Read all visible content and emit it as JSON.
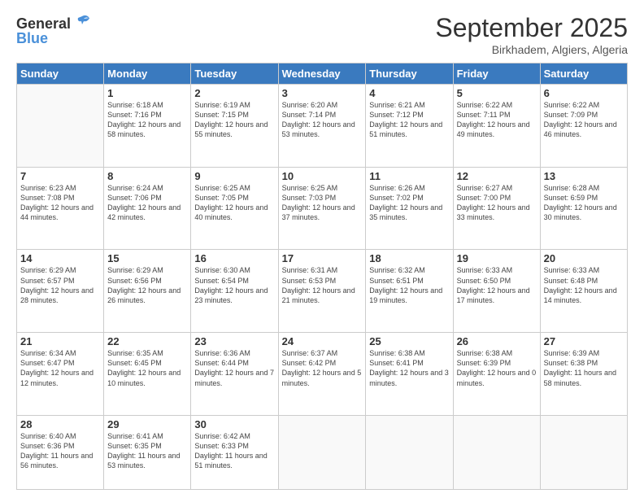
{
  "header": {
    "logo_general": "General",
    "logo_blue": "Blue",
    "month_year": "September 2025",
    "location": "Birkhadem, Algiers, Algeria"
  },
  "days_of_week": [
    "Sunday",
    "Monday",
    "Tuesday",
    "Wednesday",
    "Thursday",
    "Friday",
    "Saturday"
  ],
  "weeks": [
    [
      {
        "day": "",
        "info": ""
      },
      {
        "day": "1",
        "info": "Sunrise: 6:18 AM\nSunset: 7:16 PM\nDaylight: 12 hours and 58 minutes."
      },
      {
        "day": "2",
        "info": "Sunrise: 6:19 AM\nSunset: 7:15 PM\nDaylight: 12 hours and 55 minutes."
      },
      {
        "day": "3",
        "info": "Sunrise: 6:20 AM\nSunset: 7:14 PM\nDaylight: 12 hours and 53 minutes."
      },
      {
        "day": "4",
        "info": "Sunrise: 6:21 AM\nSunset: 7:12 PM\nDaylight: 12 hours and 51 minutes."
      },
      {
        "day": "5",
        "info": "Sunrise: 6:22 AM\nSunset: 7:11 PM\nDaylight: 12 hours and 49 minutes."
      },
      {
        "day": "6",
        "info": "Sunrise: 6:22 AM\nSunset: 7:09 PM\nDaylight: 12 hours and 46 minutes."
      }
    ],
    [
      {
        "day": "7",
        "info": "Sunrise: 6:23 AM\nSunset: 7:08 PM\nDaylight: 12 hours and 44 minutes."
      },
      {
        "day": "8",
        "info": "Sunrise: 6:24 AM\nSunset: 7:06 PM\nDaylight: 12 hours and 42 minutes."
      },
      {
        "day": "9",
        "info": "Sunrise: 6:25 AM\nSunset: 7:05 PM\nDaylight: 12 hours and 40 minutes."
      },
      {
        "day": "10",
        "info": "Sunrise: 6:25 AM\nSunset: 7:03 PM\nDaylight: 12 hours and 37 minutes."
      },
      {
        "day": "11",
        "info": "Sunrise: 6:26 AM\nSunset: 7:02 PM\nDaylight: 12 hours and 35 minutes."
      },
      {
        "day": "12",
        "info": "Sunrise: 6:27 AM\nSunset: 7:00 PM\nDaylight: 12 hours and 33 minutes."
      },
      {
        "day": "13",
        "info": "Sunrise: 6:28 AM\nSunset: 6:59 PM\nDaylight: 12 hours and 30 minutes."
      }
    ],
    [
      {
        "day": "14",
        "info": "Sunrise: 6:29 AM\nSunset: 6:57 PM\nDaylight: 12 hours and 28 minutes."
      },
      {
        "day": "15",
        "info": "Sunrise: 6:29 AM\nSunset: 6:56 PM\nDaylight: 12 hours and 26 minutes."
      },
      {
        "day": "16",
        "info": "Sunrise: 6:30 AM\nSunset: 6:54 PM\nDaylight: 12 hours and 23 minutes."
      },
      {
        "day": "17",
        "info": "Sunrise: 6:31 AM\nSunset: 6:53 PM\nDaylight: 12 hours and 21 minutes."
      },
      {
        "day": "18",
        "info": "Sunrise: 6:32 AM\nSunset: 6:51 PM\nDaylight: 12 hours and 19 minutes."
      },
      {
        "day": "19",
        "info": "Sunrise: 6:33 AM\nSunset: 6:50 PM\nDaylight: 12 hours and 17 minutes."
      },
      {
        "day": "20",
        "info": "Sunrise: 6:33 AM\nSunset: 6:48 PM\nDaylight: 12 hours and 14 minutes."
      }
    ],
    [
      {
        "day": "21",
        "info": "Sunrise: 6:34 AM\nSunset: 6:47 PM\nDaylight: 12 hours and 12 minutes."
      },
      {
        "day": "22",
        "info": "Sunrise: 6:35 AM\nSunset: 6:45 PM\nDaylight: 12 hours and 10 minutes."
      },
      {
        "day": "23",
        "info": "Sunrise: 6:36 AM\nSunset: 6:44 PM\nDaylight: 12 hours and 7 minutes."
      },
      {
        "day": "24",
        "info": "Sunrise: 6:37 AM\nSunset: 6:42 PM\nDaylight: 12 hours and 5 minutes."
      },
      {
        "day": "25",
        "info": "Sunrise: 6:38 AM\nSunset: 6:41 PM\nDaylight: 12 hours and 3 minutes."
      },
      {
        "day": "26",
        "info": "Sunrise: 6:38 AM\nSunset: 6:39 PM\nDaylight: 12 hours and 0 minutes."
      },
      {
        "day": "27",
        "info": "Sunrise: 6:39 AM\nSunset: 6:38 PM\nDaylight: 11 hours and 58 minutes."
      }
    ],
    [
      {
        "day": "28",
        "info": "Sunrise: 6:40 AM\nSunset: 6:36 PM\nDaylight: 11 hours and 56 minutes."
      },
      {
        "day": "29",
        "info": "Sunrise: 6:41 AM\nSunset: 6:35 PM\nDaylight: 11 hours and 53 minutes."
      },
      {
        "day": "30",
        "info": "Sunrise: 6:42 AM\nSunset: 6:33 PM\nDaylight: 11 hours and 51 minutes."
      },
      {
        "day": "",
        "info": ""
      },
      {
        "day": "",
        "info": ""
      },
      {
        "day": "",
        "info": ""
      },
      {
        "day": "",
        "info": ""
      }
    ]
  ]
}
